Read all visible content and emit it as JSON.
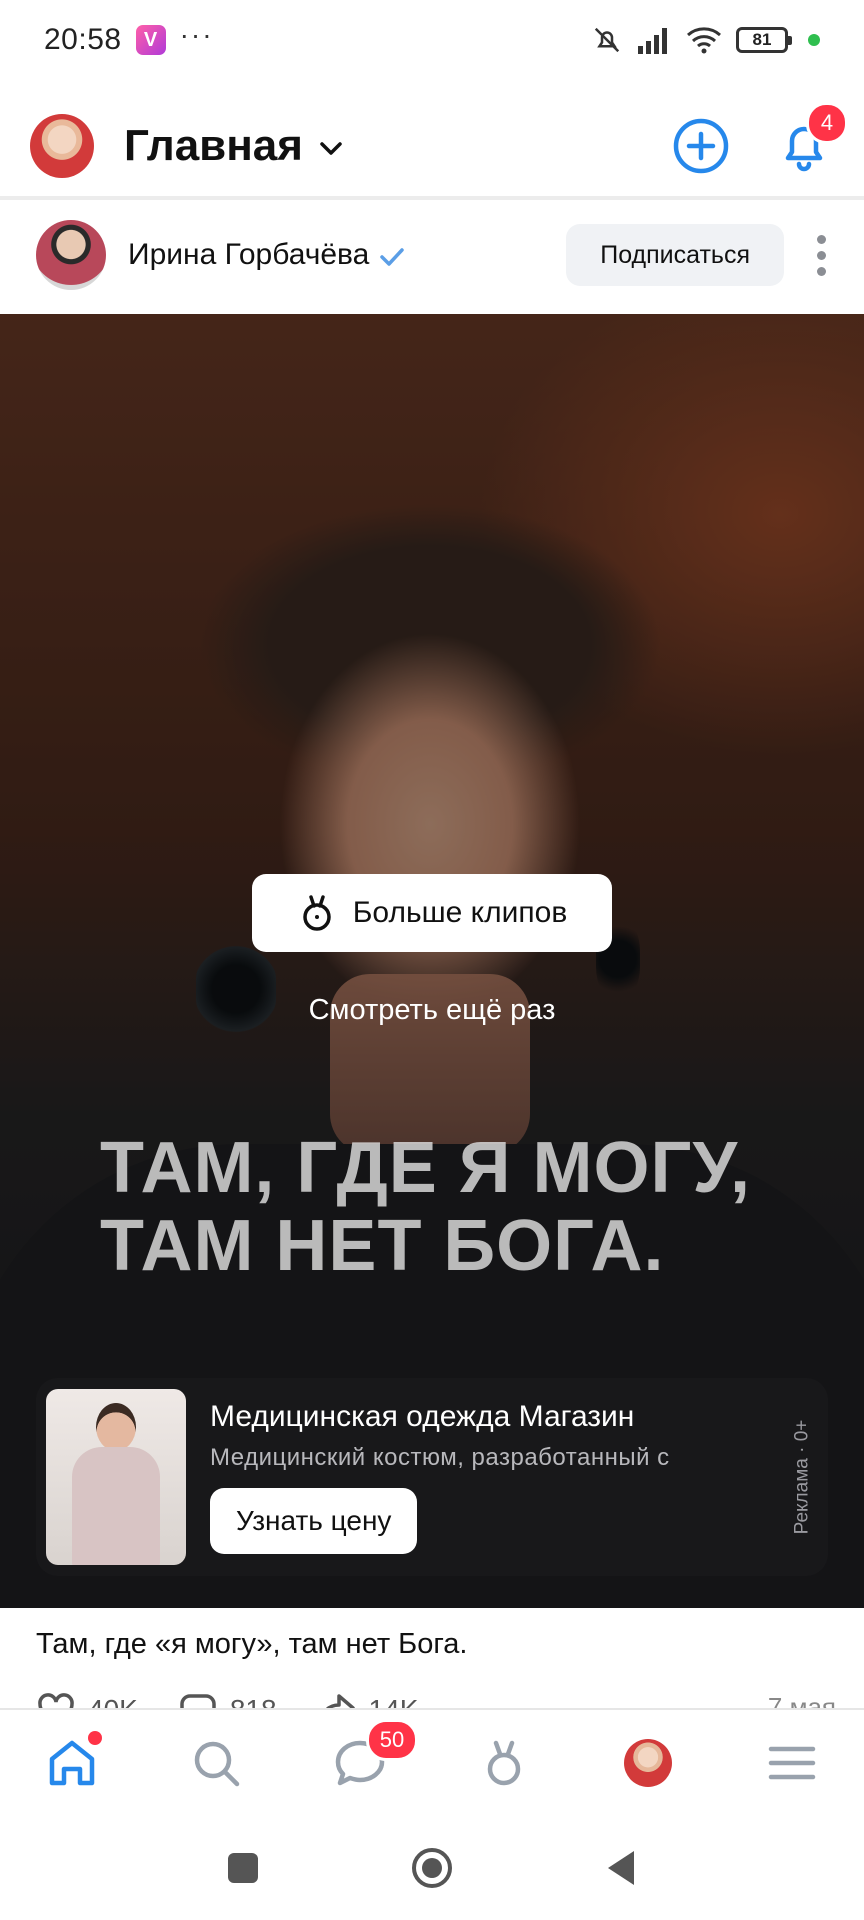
{
  "status_bar": {
    "time": "20:58",
    "battery_level": "81",
    "icons": [
      "vk-app-icon",
      "mute-icon",
      "signal-icon",
      "wifi-icon",
      "battery-icon"
    ]
  },
  "header": {
    "title": "Главная",
    "notifications_count": "4"
  },
  "post": {
    "author_name": "Ирина Горбачёва",
    "verified": true,
    "subscribe_label": "Подписаться",
    "caption": "Там, где «я могу», там нет Бога.",
    "likes": "40K",
    "comments": "818",
    "shares": "14K",
    "date": "7 мая"
  },
  "video": {
    "more_clips_label": "Больше клипов",
    "watch_again_label": "Смотреть ещё раз",
    "overlay_line1": "ТАМ, ГДЕ Я МОГУ,",
    "overlay_line2": "ТАМ НЕТ БОГА."
  },
  "ad": {
    "title": "Медицинская одежда Магазин",
    "description": "Медицинский костюм, разработанный с",
    "button_label": "Узнать цену",
    "label": "Реклама · 0+"
  },
  "tab_bar": {
    "messages_badge": "50",
    "tabs": [
      "home",
      "search",
      "messages",
      "clips",
      "profile",
      "menu"
    ]
  },
  "colors": {
    "accent": "#2688eb",
    "badge": "#ff3347",
    "tab_inactive": "#99a2ad"
  }
}
